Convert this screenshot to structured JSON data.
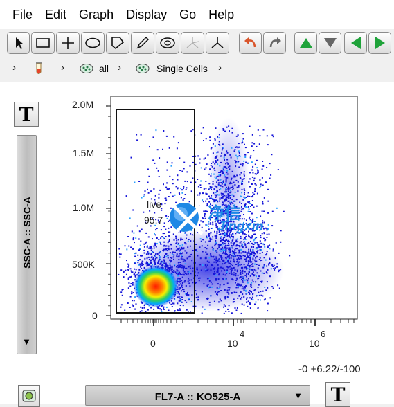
{
  "menu": [
    "File",
    "Edit",
    "Graph",
    "Display",
    "Go",
    "Help"
  ],
  "toolbar_icons": [
    "pointer-icon",
    "rectangle-gate-icon",
    "quadrant-gate-icon",
    "ellipse-gate-icon",
    "polygon-gate-icon",
    "freehand-pencil-icon",
    "curly-quad-icon",
    "spider-gate-icon",
    "web-gate-icon",
    "undo-icon",
    "redo-icon",
    "up-arrow-icon",
    "down-arrow-icon",
    "left-arrow-icon",
    "right-arrow-icon"
  ],
  "breadcrumb": {
    "items": [
      {
        "icon": "tube-icon",
        "label": ""
      },
      {
        "icon": "population-icon",
        "label": "all"
      },
      {
        "icon": "population-icon",
        "label": "Single Cells"
      }
    ]
  },
  "axes": {
    "y_label": "SSC-A :: SSC-A",
    "x_label": "FL7-A :: KO525-A",
    "y_ticks": [
      "0",
      "500K",
      "1.0M",
      "1.5M",
      "2.0M"
    ],
    "x_ticks": [
      {
        "base": "0",
        "exp": ""
      },
      {
        "base": "10",
        "exp": "4"
      },
      {
        "base": "10",
        "exp": "6"
      }
    ],
    "scale_info": "-0 +6.22/-100"
  },
  "gate": {
    "name": "live",
    "percent": "95.7"
  },
  "watermark": {
    "chinese": "净信",
    "latin": "Jingxin"
  },
  "colors": {
    "gate_stroke": "#111111",
    "high_density": "#ff2000",
    "low_density": "#1010e0",
    "watermark": "#1e88e5"
  }
}
